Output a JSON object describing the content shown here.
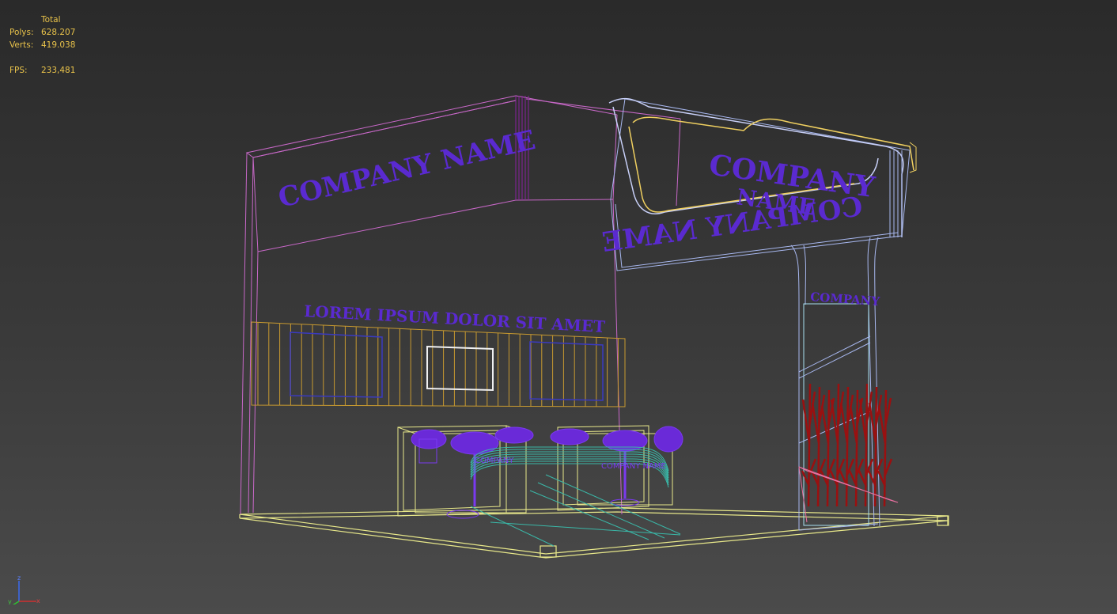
{
  "stats": {
    "header": "Total",
    "polys_label": "Polys:",
    "polys_value": "628.207",
    "verts_label": "Verts:",
    "verts_value": "419.038",
    "fps_label": "FPS:",
    "fps_value": "233,481"
  },
  "scene": {
    "company_name_left": "COMPANY NAME",
    "company_name_right_1": "COMPANY",
    "company_name_right_2": "NAME",
    "company_name_mirrored": "COMPANY NAME",
    "company_tower": "COMPANY",
    "lorem_banner": "LOREM IPSUM DOLOR SIT AMET",
    "counter_label_1": "COMPANY",
    "counter_label_2": "COMPANY NAME"
  },
  "axis": {
    "x": "x",
    "y": "y",
    "z": "z"
  },
  "colors": {
    "background_top": "#2a2a2a",
    "background_bottom": "#4b4b4b",
    "stats_text": "#e8c24a",
    "wall_wire": "#d070d0",
    "floor_wire": "#e8e88a",
    "logo_text": "#5a2ad0",
    "canopy_blue": "#a8b8f0",
    "canopy_yellow": "#f0d060",
    "plant_red": "#9a1010",
    "stool_teal": "#3ab8a8",
    "panel_orange": "#c89a30"
  }
}
